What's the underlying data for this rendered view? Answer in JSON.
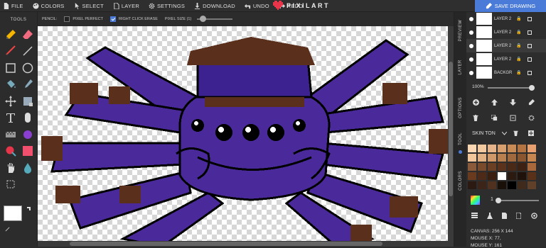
{
  "topbar": {
    "menu": [
      {
        "label": "FILE",
        "icon": "file-icon"
      },
      {
        "label": "COLORS",
        "icon": "palette-icon"
      },
      {
        "label": "SELECT",
        "icon": "cursor-icon"
      },
      {
        "label": "LAYER",
        "icon": "layer-icon"
      },
      {
        "label": "SETTINGS",
        "icon": "gear-icon"
      },
      {
        "label": "DOWNLOAD",
        "icon": "download-icon"
      },
      {
        "label": "UNDO",
        "icon": "undo-icon"
      },
      {
        "label": "REDO",
        "icon": "redo-icon"
      }
    ],
    "logo": "PIXILART",
    "save": "SAVE DRAWING"
  },
  "tools_header": "TOOLS",
  "options": {
    "pencil": "PENCIL:",
    "pixel_perfect": "PIXEL PERFECT",
    "right_click_erase": "RIGHT CLICK ERASE",
    "pixel_size": "PIXEL SIZE (1)"
  },
  "tabs": {
    "preview": "PREVIEW",
    "layer": "LAYER",
    "options": "OPTIONS",
    "tool": "TOOL",
    "colors": "COLORS"
  },
  "layers": [
    "LAYER 2",
    "LAYER 2",
    "LAYER 2",
    "LAYER 2",
    "BACKGR"
  ],
  "opacity": "100%",
  "palette_name": "SKIN TON",
  "brush_value": "1",
  "info": {
    "canvas": "CANVAS: 256 X 144",
    "mouse_x": "MOUSE X: 77,",
    "mouse_y": "MOUSE Y: 161"
  },
  "colors": {
    "accent": "#4a7bd8",
    "primary": "#ffffff",
    "palette": [
      "#fad6b2",
      "#f3c9a0",
      "#e6b48a",
      "#d9a06f",
      "#c98b55",
      "#b47442",
      "#e8a070",
      "#f2c69b",
      "#e2b183",
      "#cf9868",
      "#b9804f",
      "#a16a3e",
      "#8a5630",
      "#c68650",
      "#8b5a3a",
      "#7a4a2c",
      "#6b3f24",
      "#5b331c",
      "#4a2916",
      "#3d2112",
      "#a8683b",
      "#6a3a1e",
      "#4d2a17",
      "#3a1f11",
      "#ffffff",
      "#2b1a10",
      "#1e120b",
      "#593018",
      "#2a1a12",
      "#3c2518",
      "#50301e",
      "#1a100a",
      "#000000",
      "#3f2a1c",
      "#604028"
    ]
  }
}
